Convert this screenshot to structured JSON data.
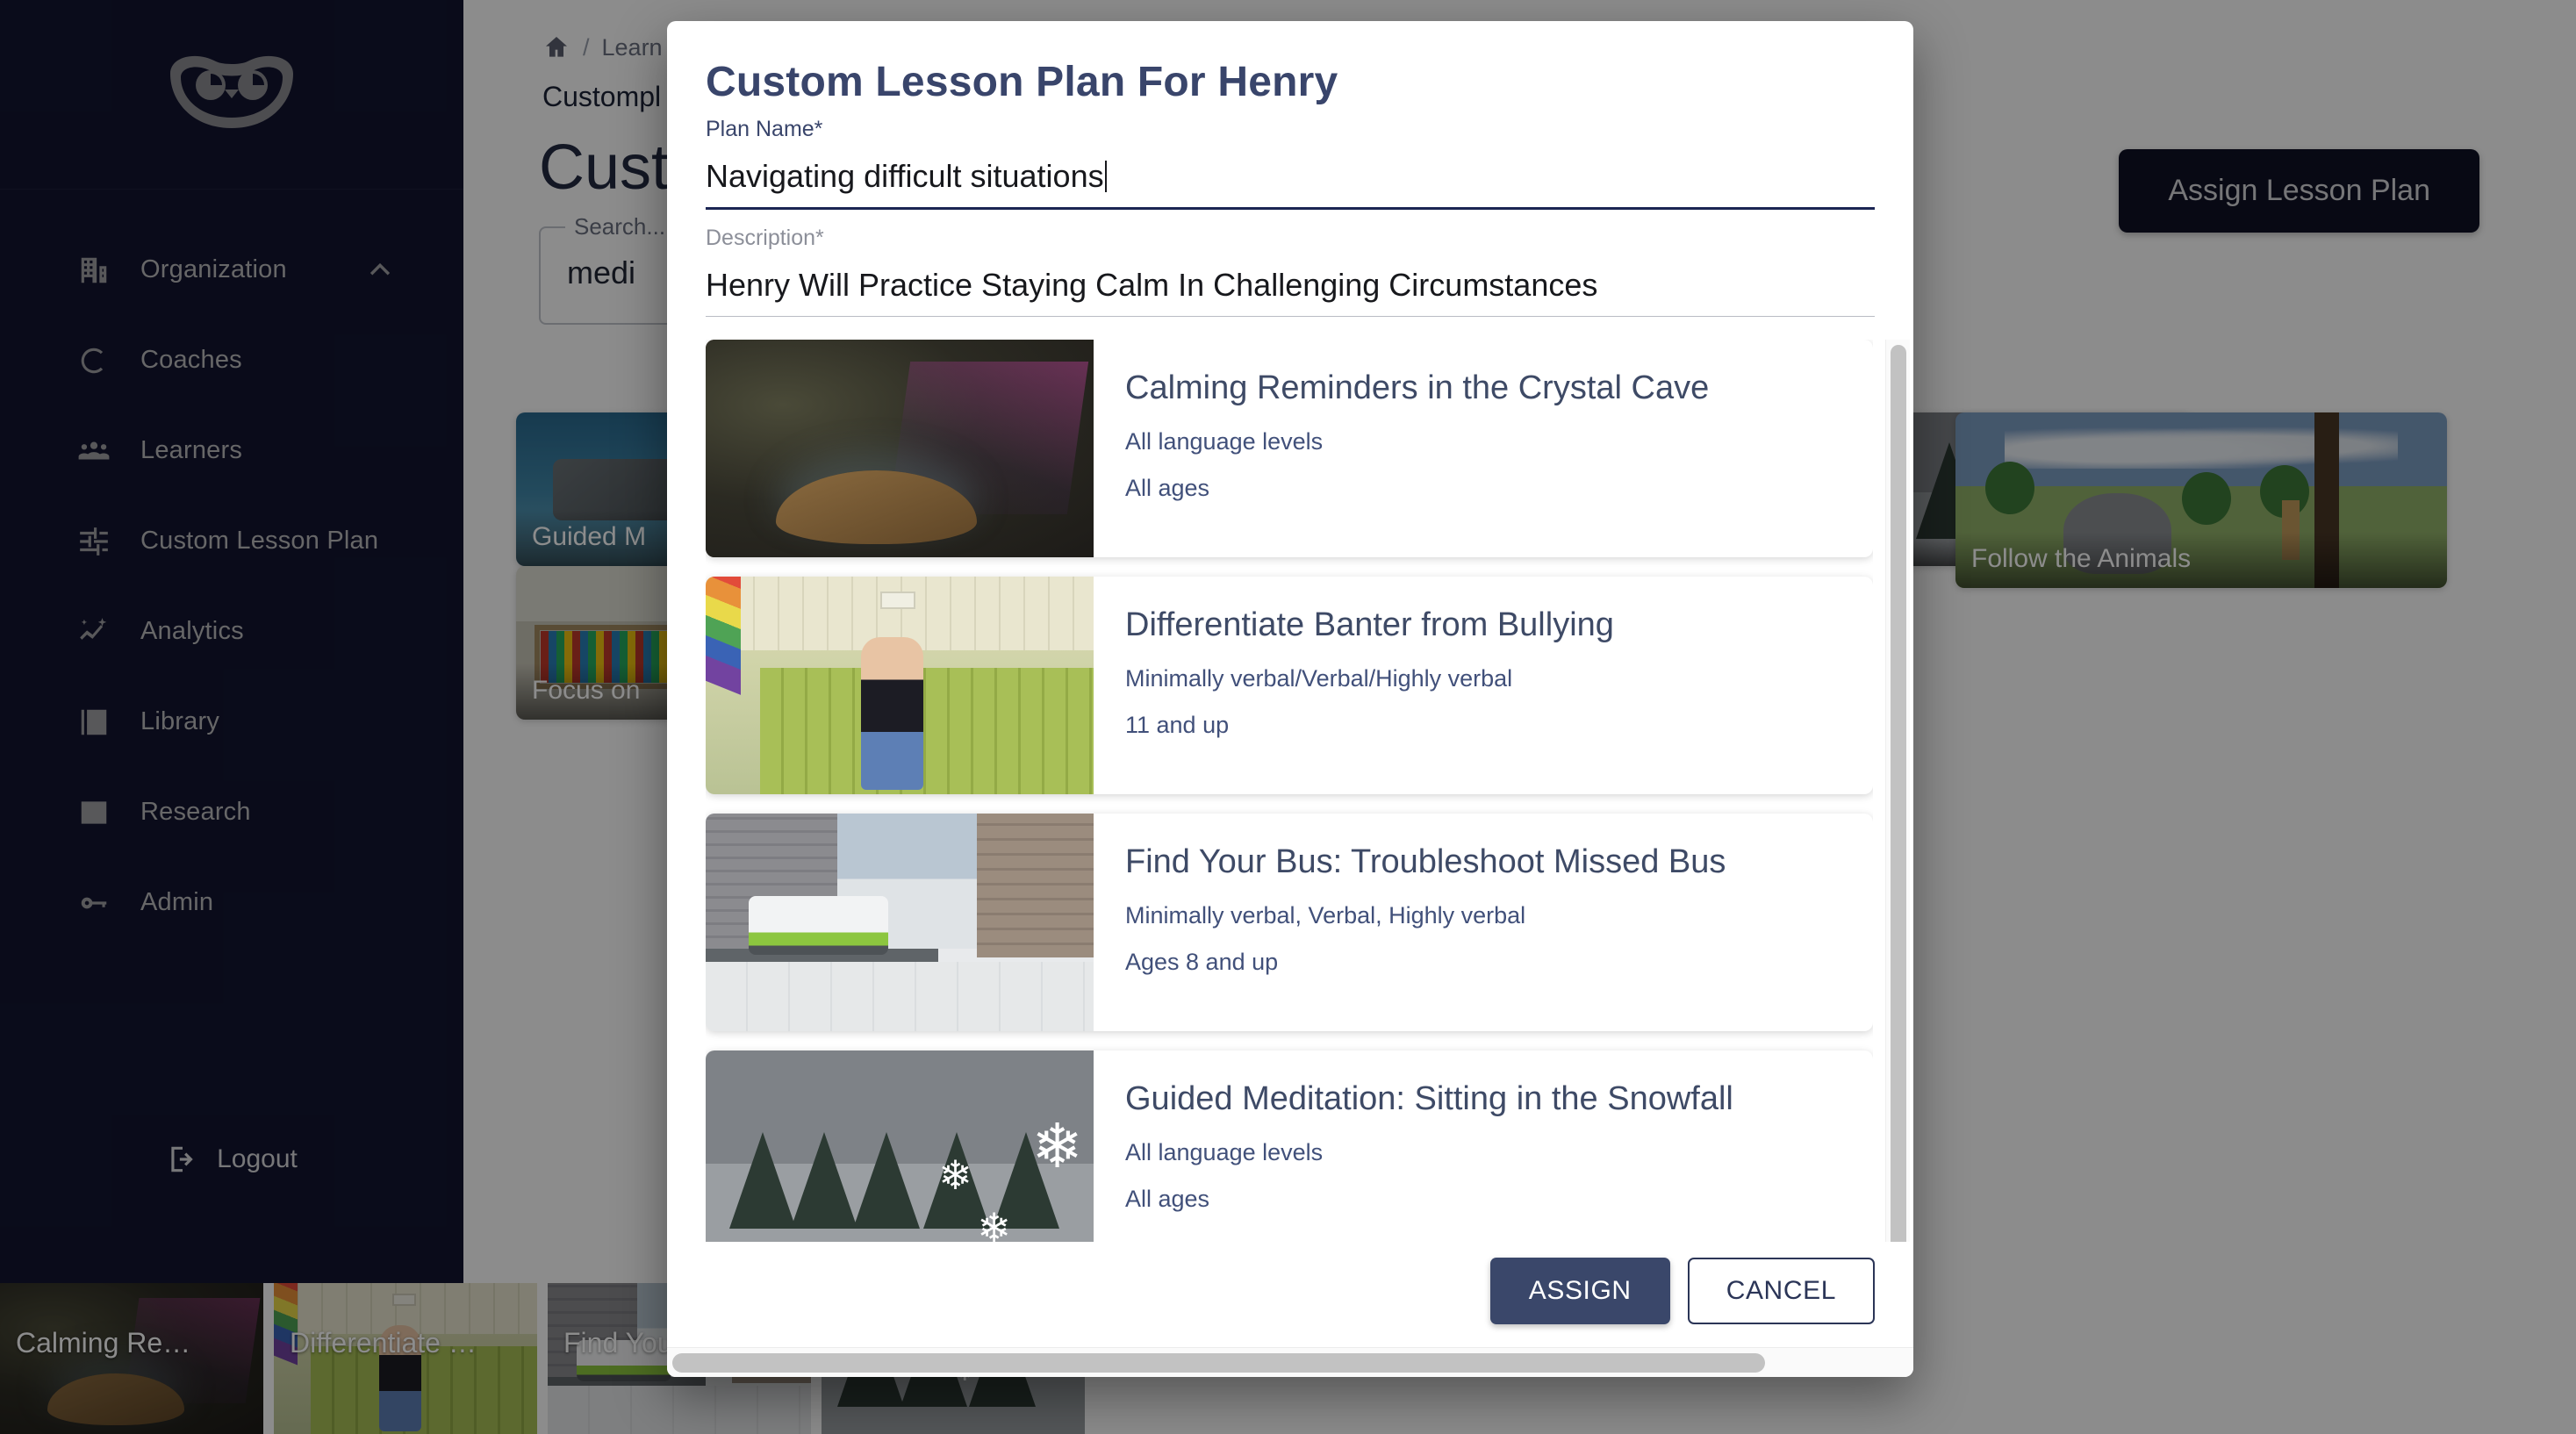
{
  "sidebar": {
    "logo_name": "owl-logo",
    "items": [
      {
        "label": "Organization",
        "icon": "building-icon",
        "expanded": true,
        "chevron": "chevron-up-icon"
      },
      {
        "label": "Coaches",
        "icon": "coach-c-icon"
      },
      {
        "label": "Learners",
        "icon": "people-group-icon"
      },
      {
        "label": "Custom Lesson Plan",
        "icon": "sliders-icon"
      },
      {
        "label": "Analytics",
        "icon": "analytics-spark-icon"
      },
      {
        "label": "Library",
        "icon": "image-library-icon"
      },
      {
        "label": "Research",
        "icon": "document-lines-icon"
      },
      {
        "label": "Admin",
        "icon": "key-icon"
      }
    ],
    "logout_label": "Logout",
    "logout_icon": "logout-arrow-icon"
  },
  "page": {
    "breadcrumb": {
      "home_icon": "home-icon",
      "separator": "/",
      "trail": "Learn",
      "current": "Custompl"
    },
    "title": "Custo",
    "search": {
      "legend": "Search...",
      "value": "medi"
    },
    "assign_plan_button": "Assign Lesson Plan",
    "thumbnails": [
      {
        "caption": "Guided M",
        "art": "art-sea"
      },
      {
        "caption": "Focus on",
        "art": "art-library"
      },
      {
        "caption": "",
        "art": "art-snow"
      },
      {
        "caption": "Follow the Animals",
        "art": "art-safari"
      }
    ],
    "strip": [
      {
        "caption": "Calming Re…",
        "art": "art-cave"
      },
      {
        "caption": "Differentiate …",
        "art": "art-hall"
      },
      {
        "caption": "Find Your",
        "art": "art-street"
      },
      {
        "caption": "",
        "art": "art-snow"
      }
    ]
  },
  "modal": {
    "title": "Custom Lesson Plan For Henry",
    "plan_name": {
      "label": "Plan Name*",
      "value": "Navigating difficult situations"
    },
    "description": {
      "label": "Description*",
      "value": "Henry Will Practice Staying Calm In Challenging Circumstances"
    },
    "lessons": [
      {
        "name": "Calming Reminders in the Crystal Cave",
        "language": "All language levels",
        "ages": "All ages",
        "art": "art-cave"
      },
      {
        "name": "Differentiate Banter from Bullying",
        "language": "Minimally verbal/Verbal/Highly verbal",
        "ages": "11 and up",
        "art": "art-hall"
      },
      {
        "name": "Find Your Bus: Troubleshoot Missed Bus",
        "language": "Minimally verbal, Verbal, Highly verbal",
        "ages": "Ages 8 and up",
        "art": "art-street"
      },
      {
        "name": "Guided Meditation: Sitting in the Snowfall",
        "language": "All language levels",
        "ages": "All ages",
        "art": "art-snow"
      }
    ],
    "assign_label": "ASSIGN",
    "cancel_label": "CANCEL"
  },
  "colors": {
    "sidebar_bg": "#131531",
    "modal_title": "#39456b",
    "lesson_title": "#3e4a66",
    "assign_btn": "#3a476a",
    "focus_underline": "#1b2553"
  }
}
